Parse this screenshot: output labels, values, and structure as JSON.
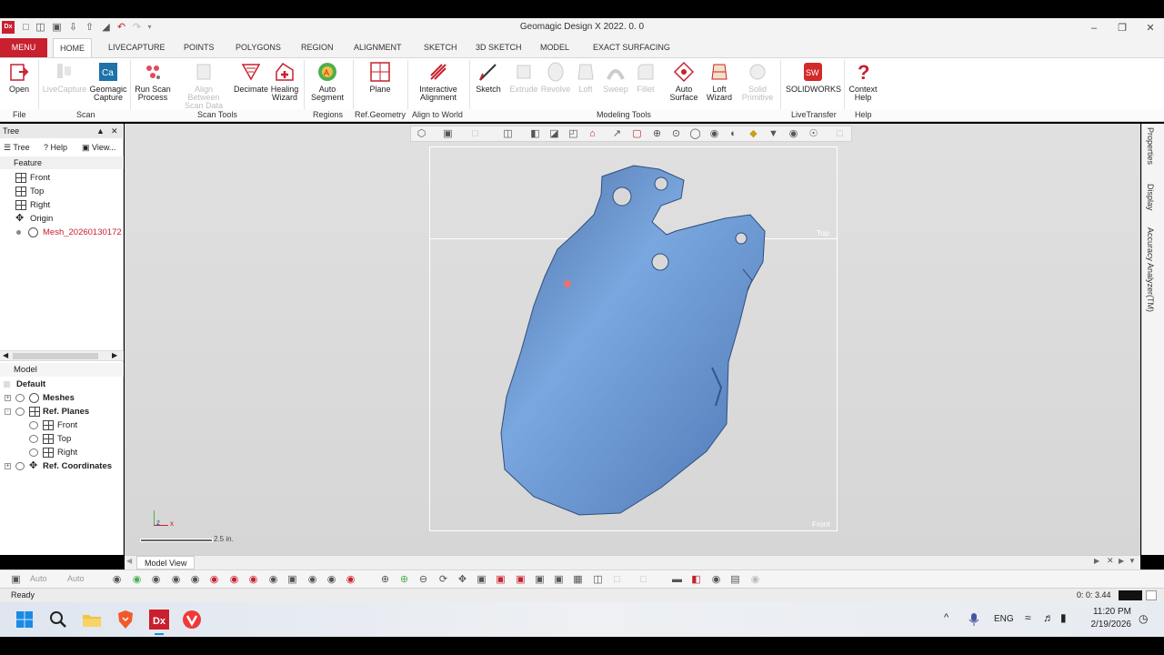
{
  "app": {
    "title": "Geomagic Design X 2022. 0. 0",
    "icon_text": "Dx"
  },
  "menu_tabs": {
    "menu_label": "MENU",
    "tabs": [
      "HOME",
      "LIVECAPTURE",
      "POINTS",
      "POLYGONS",
      "REGION",
      "ALIGNMENT",
      "SKETCH",
      "3D SKETCH",
      "MODEL",
      "EXACT SURFACING"
    ],
    "active": "HOME"
  },
  "ribbon": {
    "buttons": [
      {
        "l1": "Open",
        "l2": "",
        "enabled": true,
        "icon": "open-icon"
      },
      {
        "l1": "LiveCapture",
        "l2": "",
        "enabled": false,
        "icon": "livecapture-icon"
      },
      {
        "l1": "Geomagic",
        "l2": "Capture",
        "enabled": true,
        "icon": "capture-icon"
      },
      {
        "l1": "Run Scan",
        "l2": "Process",
        "enabled": true,
        "icon": "scan-process-icon"
      },
      {
        "l1": "Align Between",
        "l2": "Scan Data",
        "enabled": false,
        "icon": "align-scan-icon"
      },
      {
        "l1": "Decimate",
        "l2": "",
        "enabled": true,
        "icon": "decimate-icon"
      },
      {
        "l1": "Healing",
        "l2": "Wizard",
        "enabled": true,
        "icon": "healing-icon"
      },
      {
        "l1": "Auto",
        "l2": "Segment",
        "enabled": true,
        "icon": "auto-segment-icon"
      },
      {
        "l1": "Plane",
        "l2": "",
        "enabled": true,
        "icon": "plane-icon"
      },
      {
        "l1": "Interactive",
        "l2": "Alignment",
        "enabled": true,
        "icon": "interactive-alignment-icon"
      },
      {
        "l1": "Sketch",
        "l2": "",
        "enabled": true,
        "icon": "sketch-icon"
      },
      {
        "l1": "Extrude",
        "l2": "",
        "enabled": false,
        "icon": "extrude-icon"
      },
      {
        "l1": "Revolve",
        "l2": "",
        "enabled": false,
        "icon": "revolve-icon"
      },
      {
        "l1": "Loft",
        "l2": "",
        "enabled": false,
        "icon": "loft-icon"
      },
      {
        "l1": "Sweep",
        "l2": "",
        "enabled": false,
        "icon": "sweep-icon"
      },
      {
        "l1": "Fillet",
        "l2": "",
        "enabled": false,
        "icon": "fillet-icon"
      },
      {
        "l1": "Auto",
        "l2": "Surface",
        "enabled": true,
        "icon": "auto-surface-icon"
      },
      {
        "l1": "Loft",
        "l2": "Wizard",
        "enabled": true,
        "icon": "loft-wizard-icon"
      },
      {
        "l1": "Solid",
        "l2": "Primitive",
        "enabled": false,
        "icon": "solid-primitive-icon"
      },
      {
        "l1": "SOLIDWORKS",
        "l2": "",
        "enabled": true,
        "icon": "solidworks-icon"
      },
      {
        "l1": "Context",
        "l2": "Help",
        "enabled": true,
        "icon": "help-icon"
      }
    ],
    "groups": [
      "File",
      "Scan",
      "Scan Tools",
      "Regions",
      "Ref.Geometry",
      "Align to World",
      "Modeling Tools",
      "LiveTransfer",
      "Help"
    ]
  },
  "tree_panel": {
    "title": "Tree",
    "tabs": [
      "Tree",
      "Help",
      "View..."
    ],
    "feature_header": "Feature",
    "features": [
      "Front",
      "Top",
      "Right",
      "Origin",
      "Mesh_20260130172"
    ],
    "model_header": "Model",
    "model_items": {
      "default": "Default",
      "meshes": "Meshes",
      "ref_planes": "Ref. Planes",
      "planes": [
        "Front",
        "Top",
        "Right"
      ],
      "ref_coordinates": "Ref. Coordinates"
    }
  },
  "viewport": {
    "label_top": "Top",
    "label_front": "Front",
    "scale_text": "2.5 in.",
    "axis_z": "z",
    "axis_x": "x",
    "mesh_color": "#6f9bd6"
  },
  "right_tabs": [
    "Properties",
    "Display",
    "Accuracy Analyzer(TM)"
  ],
  "model_view_tab": "Model View",
  "bottom_toolbar": {
    "auto1": "Auto",
    "auto2": "Auto"
  },
  "status": {
    "text": "Ready",
    "time": "0: 0: 3.44"
  },
  "taskbar": {
    "lang": "ENG",
    "time": "11:20 PM",
    "date": "2/19/2026"
  }
}
